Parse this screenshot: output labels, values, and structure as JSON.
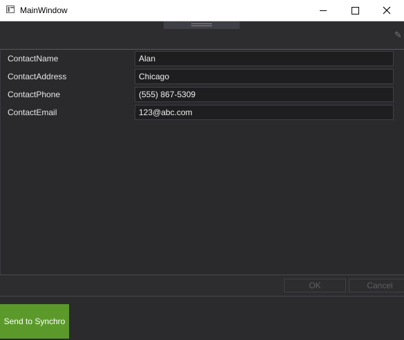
{
  "window": {
    "title": "MainWindow"
  },
  "form": {
    "fields": [
      {
        "label": "ContactName",
        "value": "Alan"
      },
      {
        "label": "ContactAddress",
        "value": "Chicago"
      },
      {
        "label": "ContactPhone",
        "value": "(555) 867-5309"
      },
      {
        "label": "ContactEmail",
        "value": "123@abc.com"
      }
    ]
  },
  "buttons": {
    "ok": "OK",
    "cancel": "Cancel",
    "send": "Send to Synchro"
  },
  "colors": {
    "background": "#2b2b2e",
    "send_button": "#5b9a2a"
  },
  "icons": [
    "app-icon",
    "minimize-icon",
    "maximize-icon",
    "close-icon",
    "drag-grip-icon",
    "pencil-icon"
  ]
}
